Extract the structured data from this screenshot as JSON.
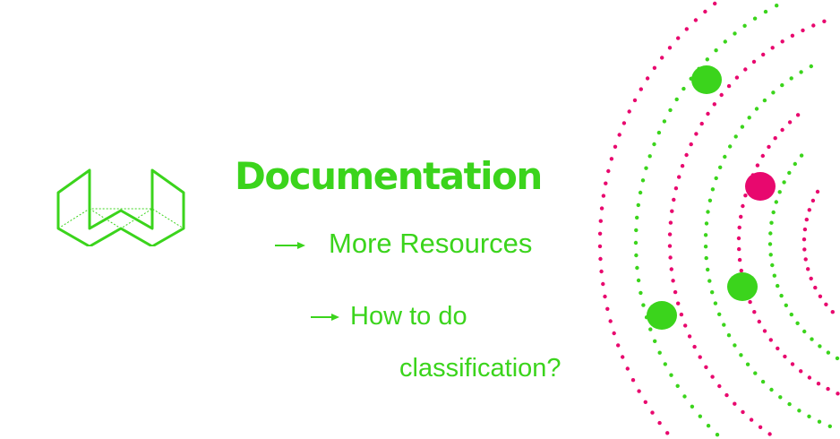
{
  "title": "Documentation",
  "links": {
    "more_resources": "More Resources",
    "how_to_line1": "How to do",
    "how_to_line2": "classification?"
  },
  "icons": {
    "logo": "wireframe-w-logo",
    "arrow": "arrow-right-icon",
    "decoration": "dotted-orbit-rings"
  },
  "colors": {
    "accent_green": "#3bd41c",
    "accent_pink": "#e8086e"
  }
}
